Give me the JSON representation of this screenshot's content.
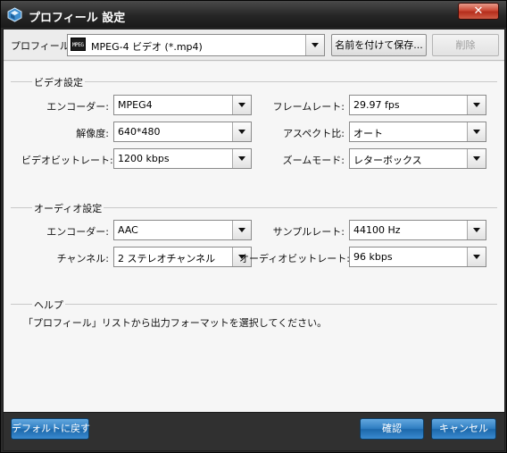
{
  "window": {
    "title": "プロフィール 設定",
    "close_glyph": "✕"
  },
  "profile": {
    "label": "プロフィール:",
    "selected": "MPEG-4 ビデオ (*.mp4)",
    "icon": "mpeg-icon",
    "icon_text": "MPEG",
    "save_as_label": "名前を付けて保存...",
    "delete_label": "削除"
  },
  "video": {
    "section_title": "ビデオ設定",
    "encoder_label": "エンコーダー:",
    "encoder_value": "MPEG4",
    "resolution_label": "解像度:",
    "resolution_value": "640*480",
    "bitrate_label": "ビデオビットレート:",
    "bitrate_value": "1200 kbps",
    "framerate_label": "フレームレート:",
    "framerate_value": "29.97 fps",
    "aspect_label": "アスペクト比:",
    "aspect_value": "オート",
    "zoom_label": "ズームモード:",
    "zoom_value": "レターボックス"
  },
  "audio": {
    "section_title": "オーディオ設定",
    "encoder_label": "エンコーダー:",
    "encoder_value": "AAC",
    "channels_label": "チャンネル:",
    "channels_value": "2 ステレオチャンネル",
    "samplerate_label": "サンプルレート:",
    "samplerate_value": "44100 Hz",
    "bitrate_label": "オーディオビットレート:",
    "bitrate_value": "96 kbps"
  },
  "help": {
    "section_title": "ヘルプ",
    "text": "「プロフィール」リストから出力フォーマットを選択してください。"
  },
  "footer": {
    "reset_label": "デフォルトに戻す",
    "ok_label": "確認",
    "cancel_label": "キャンセル"
  },
  "colors": {
    "accent_blue": "#2d7cc0",
    "close_red": "#cc4a36",
    "dark_frame": "#2b2b2b"
  }
}
